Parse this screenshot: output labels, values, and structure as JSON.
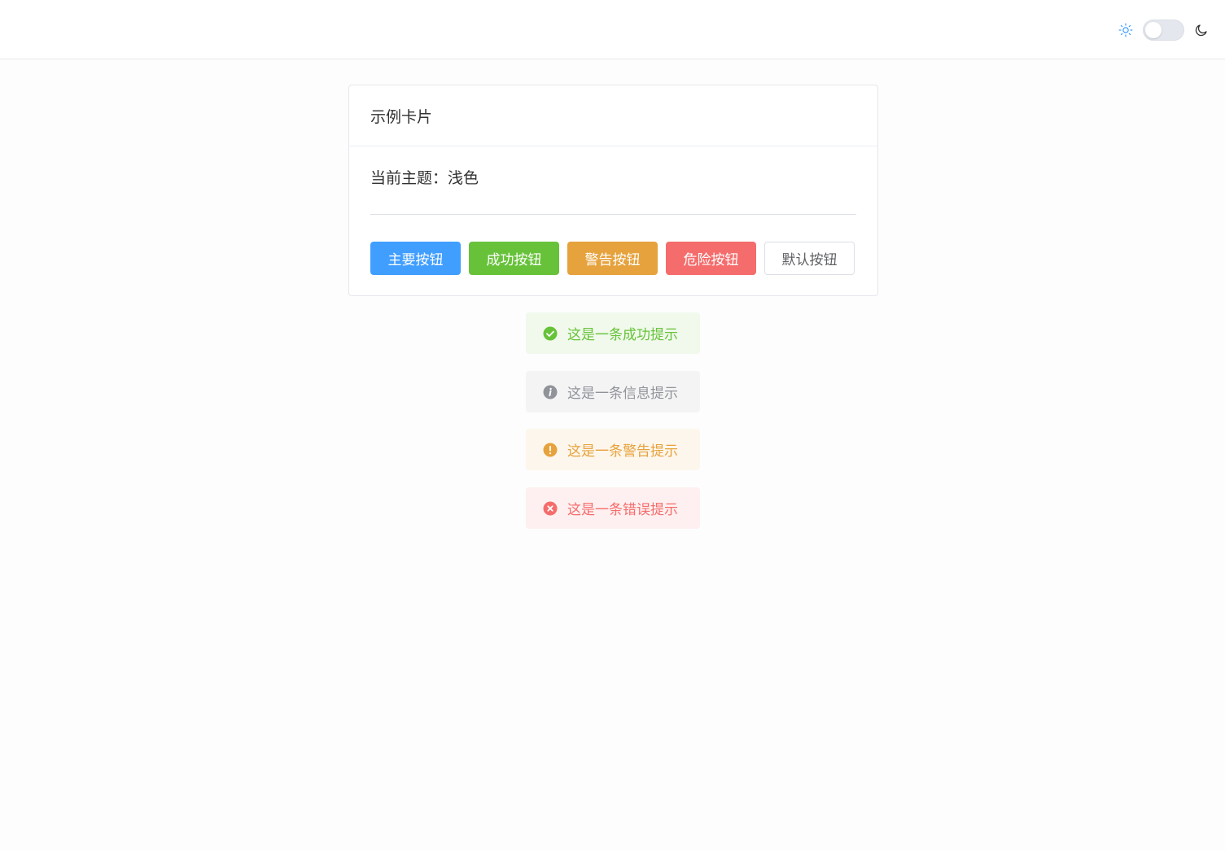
{
  "header": {
    "theme_switch": {
      "light_icon": "sun-icon",
      "dark_icon": "moon-icon",
      "checked": false
    }
  },
  "card": {
    "title": "示例卡片",
    "current_theme": "当前主题：浅色",
    "buttons": [
      {
        "label": "主要按钮",
        "type": "primary",
        "color": "#409eff"
      },
      {
        "label": "成功按钮",
        "type": "success",
        "color": "#67c23a"
      },
      {
        "label": "警告按钮",
        "type": "warning",
        "color": "#e6a23c"
      },
      {
        "label": "危险按钮",
        "type": "danger",
        "color": "#f56c6c"
      },
      {
        "label": "默认按钮",
        "type": "default",
        "color": "#ffffff"
      }
    ]
  },
  "alerts": [
    {
      "type": "success",
      "text": "这是一条成功提示",
      "icon": "check-circle-icon",
      "color": "#67c23a"
    },
    {
      "type": "info",
      "text": "这是一条信息提示",
      "icon": "info-circle-icon",
      "color": "#909399"
    },
    {
      "type": "warning",
      "text": "这是一条警告提示",
      "icon": "warning-circle-icon",
      "color": "#e6a23c"
    },
    {
      "type": "error",
      "text": "这是一条错误提示",
      "icon": "close-circle-icon",
      "color": "#f56c6c"
    }
  ]
}
